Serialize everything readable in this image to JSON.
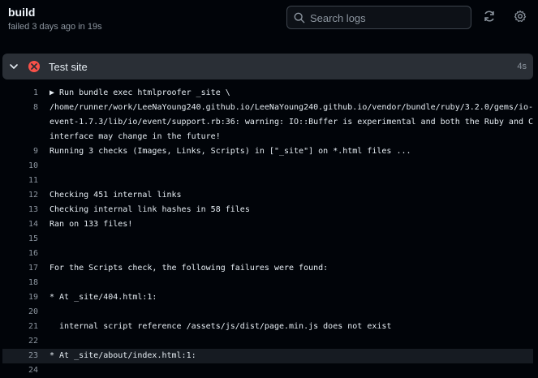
{
  "header": {
    "title": "build",
    "subtitle": "failed 3 days ago in 19s",
    "search_placeholder": "Search logs"
  },
  "step": {
    "name": "Test site",
    "duration": "4s",
    "status": "failed"
  },
  "log_lines": [
    {
      "num": "1",
      "text": "▶ Run bundle exec htmlproofer _site \\"
    },
    {
      "num": "8",
      "text": "/home/runner/work/LeeNaYoung240.github.io/LeeNaYoung240.github.io/vendor/bundle/ruby/3.2.0/gems/io-"
    },
    {
      "num": "",
      "text": "event-1.7.3/lib/io/event/support.rb:36: warning: IO::Buffer is experimental and both the Ruby and C"
    },
    {
      "num": "",
      "text": "interface may change in the future!"
    },
    {
      "num": "9",
      "text": "Running 3 checks (Images, Links, Scripts) in [\"_site\"] on *.html files ..."
    },
    {
      "num": "10",
      "text": ""
    },
    {
      "num": "11",
      "text": ""
    },
    {
      "num": "12",
      "text": "Checking 451 internal links"
    },
    {
      "num": "13",
      "text": "Checking internal link hashes in 58 files"
    },
    {
      "num": "14",
      "text": "Ran on 133 files!"
    },
    {
      "num": "15",
      "text": ""
    },
    {
      "num": "16",
      "text": ""
    },
    {
      "num": "17",
      "text": "For the Scripts check, the following failures were found:"
    },
    {
      "num": "18",
      "text": ""
    },
    {
      "num": "19",
      "text": "* At _site/404.html:1:"
    },
    {
      "num": "20",
      "text": ""
    },
    {
      "num": "21",
      "text": "  internal script reference /assets/js/dist/page.min.js does not exist"
    },
    {
      "num": "22",
      "text": ""
    },
    {
      "num": "23",
      "text": "* At _site/about/index.html:1:",
      "highlighted": true
    },
    {
      "num": "24",
      "text": ""
    }
  ],
  "colors": {
    "background": "#010409",
    "step_bar": "#2a2f36",
    "failure": "#f85149",
    "highlight_row": "#161b22"
  }
}
